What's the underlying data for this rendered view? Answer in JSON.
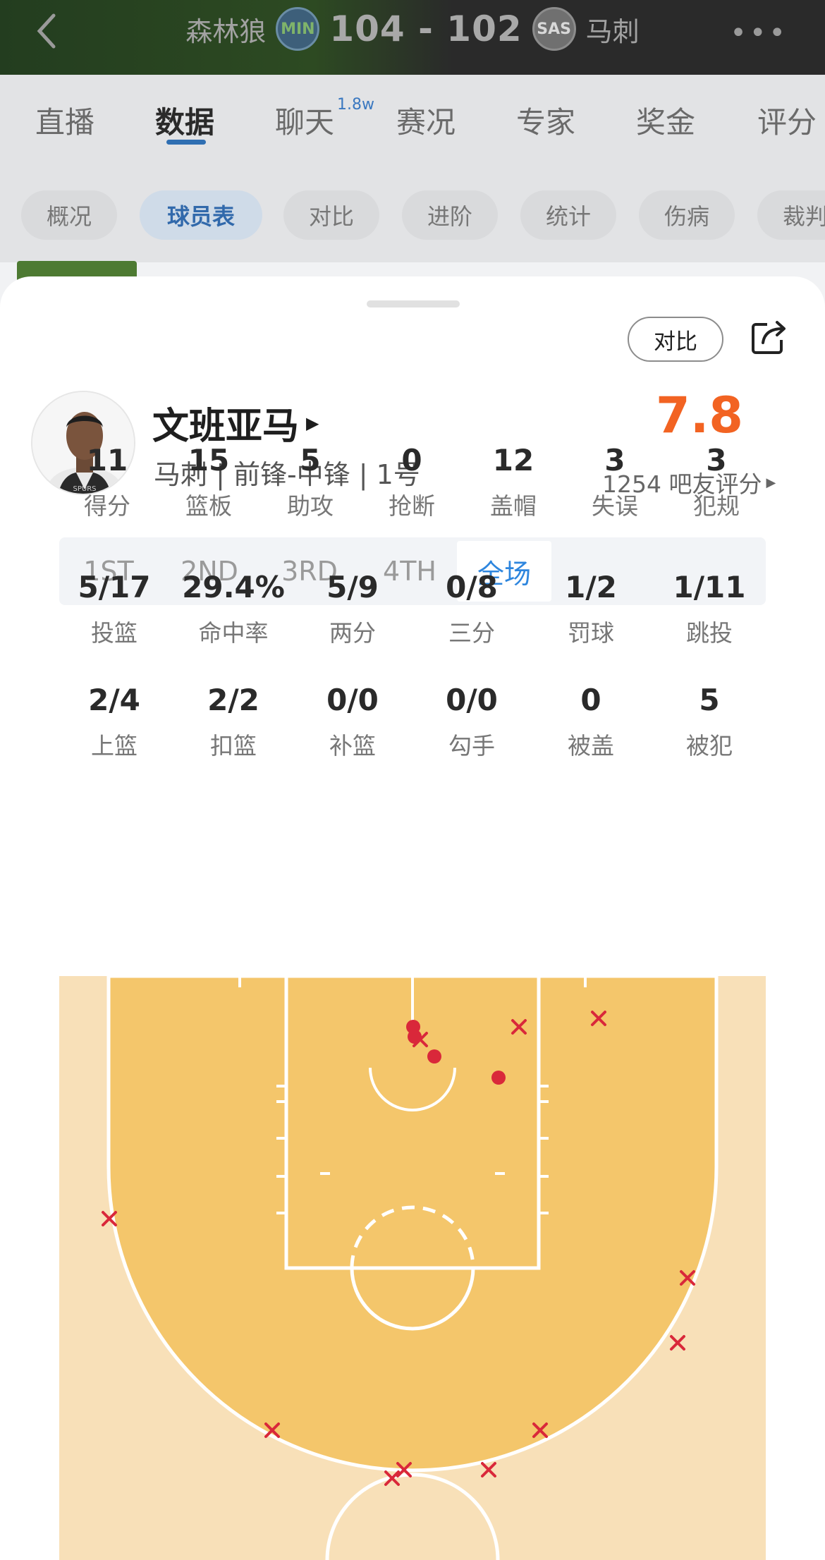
{
  "header": {
    "home_team": "森林狼",
    "home_logo": "MIN",
    "score": "104 - 102",
    "away_logo": "SAS",
    "away_team": "马刺",
    "more_icon": "more-dots-icon",
    "back_icon": "chevron-left-icon"
  },
  "tabs": [
    {
      "label": "直播"
    },
    {
      "label": "数据"
    },
    {
      "label": "聊天"
    },
    {
      "label": "赛况"
    },
    {
      "label": "专家"
    },
    {
      "label": "奖金"
    },
    {
      "label": "评分"
    }
  ],
  "chat_badge": "1.8w",
  "subtabs": [
    {
      "label": "概况"
    },
    {
      "label": "球员表"
    },
    {
      "label": "对比"
    },
    {
      "label": "进阶"
    },
    {
      "label": "统计"
    },
    {
      "label": "伤病"
    },
    {
      "label": "裁判"
    }
  ],
  "sheet": {
    "compare_label": "对比",
    "share_icon": "share-icon",
    "player_name": "文班亚马",
    "player_meta": "马刺 | 前锋-中锋 | 1号",
    "rating": "7.8",
    "rating_sub": "1254 吧友评分",
    "periods": [
      "1ST",
      "2ND",
      "3RD",
      "4TH",
      "全场"
    ],
    "active_period": "全场",
    "stats_row1": [
      {
        "value": "11",
        "label": "得分"
      },
      {
        "value": "15",
        "label": "篮板"
      },
      {
        "value": "5",
        "label": "助攻"
      },
      {
        "value": "0",
        "label": "抢断"
      },
      {
        "value": "12",
        "label": "盖帽"
      },
      {
        "value": "3",
        "label": "失误"
      },
      {
        "value": "3",
        "label": "犯规"
      }
    ],
    "stats_row2": [
      {
        "value": "5/17",
        "label": "投篮"
      },
      {
        "value": "29.4%",
        "label": "命中率"
      },
      {
        "value": "5/9",
        "label": "两分"
      },
      {
        "value": "0/8",
        "label": "三分"
      },
      {
        "value": "1/2",
        "label": "罚球"
      },
      {
        "value": "1/11",
        "label": "跳投"
      }
    ],
    "stats_row3": [
      {
        "value": "2/4",
        "label": "上篮"
      },
      {
        "value": "2/2",
        "label": "扣篮"
      },
      {
        "value": "0/0",
        "label": "补篮"
      },
      {
        "value": "0/0",
        "label": "勾手"
      },
      {
        "value": "0",
        "label": "被盖"
      },
      {
        "value": "5",
        "label": "被犯"
      }
    ],
    "colors": {
      "rating": "#f26322",
      "active_period": "#2e86de",
      "paint": "#f4c66b",
      "court_outer": "#f8e0b8",
      "shot_mark": "#d9283a"
    }
  }
}
